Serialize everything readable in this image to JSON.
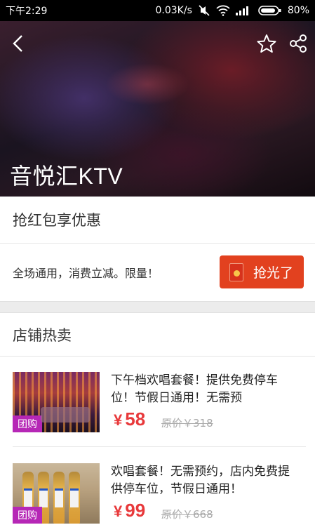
{
  "status_bar": {
    "time": "下午2:29",
    "speed": "0.03K/s",
    "network_type": "3G\n1X",
    "battery": "80%"
  },
  "header": {
    "store_name": "音悦汇KTV",
    "icons": [
      "back-arrow-icon",
      "star-icon",
      "share-icon"
    ]
  },
  "coupon": {
    "section_title": "抢红包享优惠",
    "description": "全场通用，消费立减。限量！",
    "button_label": "抢光了",
    "button_color": "#e2411f"
  },
  "hot_sales": {
    "section_title": "店铺热卖",
    "items": [
      {
        "badge": "团购",
        "title": "下午档欢唱套餐！提供免费停车位！节假日通用！无需预",
        "currency": "¥",
        "price": "58",
        "original_price": "原价￥318"
      },
      {
        "badge": "团购",
        "title": "欢唱套餐！无需预约，店内免费提供停车位，节假日通用！",
        "currency": "¥",
        "price": "99",
        "original_price": "原价￥668"
      }
    ]
  },
  "colors": {
    "accent_red": "#e8393b",
    "badge_purple": "#b627b6"
  }
}
